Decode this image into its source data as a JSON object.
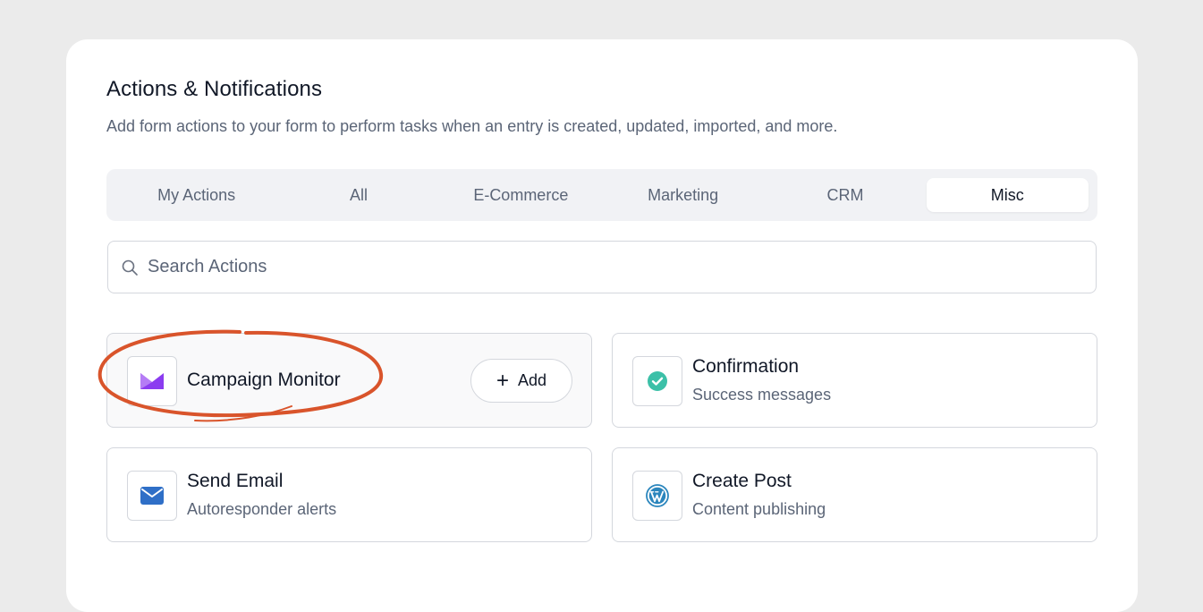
{
  "header": {
    "title": "Actions & Notifications",
    "subtitle": "Add form actions to your form to perform tasks when an entry is created, updated, imported, and more."
  },
  "tabs": [
    {
      "label": "My Actions",
      "active": false
    },
    {
      "label": "All",
      "active": false
    },
    {
      "label": "E-Commerce",
      "active": false
    },
    {
      "label": "Marketing",
      "active": false
    },
    {
      "label": "CRM",
      "active": false
    },
    {
      "label": "Misc",
      "active": true
    }
  ],
  "search": {
    "placeholder": "Search Actions",
    "value": "",
    "icon": "search-icon"
  },
  "actions": [
    {
      "name": "Campaign Monitor",
      "description": "",
      "icon": "campaign-monitor-icon",
      "button_label": "Add",
      "highlighted": true
    },
    {
      "name": "Confirmation",
      "description": "Success messages",
      "icon": "check-circle-icon"
    },
    {
      "name": "Send Email",
      "description": "Autoresponder alerts",
      "icon": "envelope-icon"
    },
    {
      "name": "Create Post",
      "description": "Content publishing",
      "icon": "wordpress-icon"
    }
  ],
  "colors": {
    "annotation": "#d9542b",
    "campaign_monitor": "#8b3cf0",
    "confirmation": "#3cc0a8",
    "email": "#2f6fc7",
    "wordpress": "#2b86bd"
  }
}
